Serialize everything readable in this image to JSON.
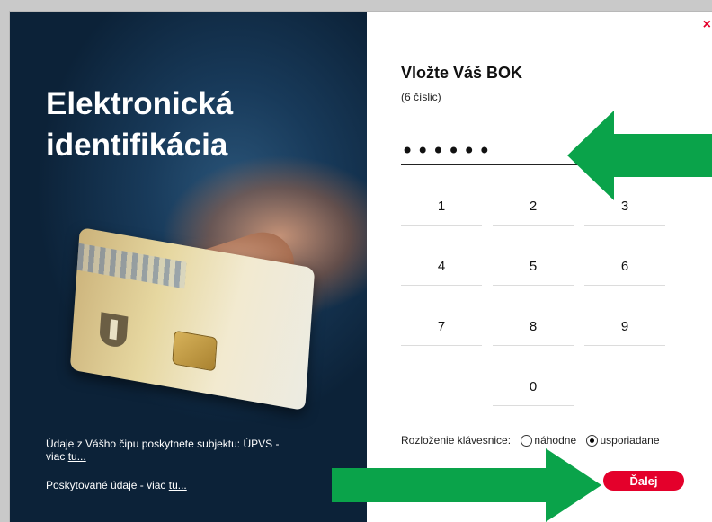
{
  "left": {
    "title_line1": "Elektronická",
    "title_line2": "identifikácia",
    "footer1_text": "Údaje z Vášho čipu poskytnete subjektu: ÚPVS - viac ",
    "footer1_link": "tu...",
    "footer2_text": "Poskytované údaje - viac ",
    "footer2_link": "tu..."
  },
  "right": {
    "close_label": "×",
    "title": "Vložte Váš BOK",
    "subtitle": "(6 číslic)",
    "pin_value": "••••••",
    "keys": [
      "1",
      "2",
      "3",
      "4",
      "5",
      "6",
      "7",
      "8",
      "9",
      "0"
    ],
    "layout_label": "Rozloženie klávesnice:",
    "layout_options": [
      "náhodne",
      "usporiadane"
    ],
    "layout_selected": "usporiadane",
    "next_label": "Ďalej"
  },
  "colors": {
    "accent": "#e4002b",
    "arrow": "#0aa34a"
  }
}
